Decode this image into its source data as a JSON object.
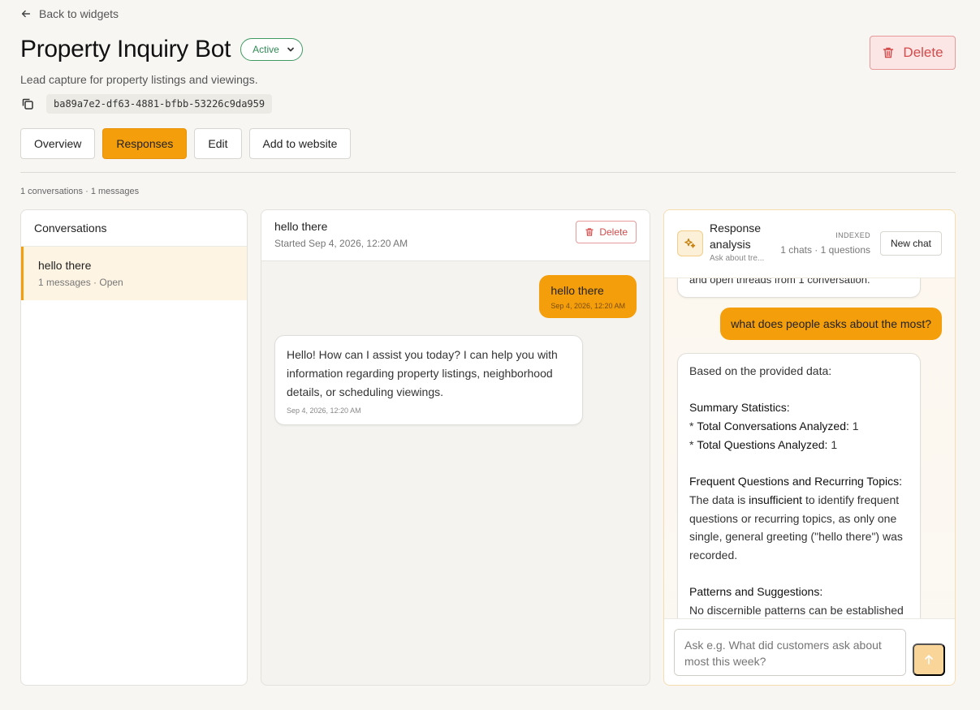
{
  "nav": {
    "back_label": "Back to widgets"
  },
  "header": {
    "title": "Property Inquiry Bot",
    "status": "Active",
    "delete_label": "Delete",
    "subtitle": "Lead capture for property listings and viewings.",
    "widget_id": "ba89a7e2-df63-4881-bfbb-53226c9da959"
  },
  "tabs": [
    {
      "label": "Overview",
      "active": false
    },
    {
      "label": "Responses",
      "active": true
    },
    {
      "label": "Edit",
      "active": false
    },
    {
      "label": "Add to website",
      "active": false
    }
  ],
  "summary": {
    "counts": "1 conversations · 1 messages"
  },
  "conversations": {
    "header": "Conversations",
    "items": [
      {
        "title": "hello there",
        "meta": "1 messages · Open"
      }
    ]
  },
  "chat": {
    "title": "hello there",
    "started": "Started Sep 4, 2026, 12:20 AM",
    "delete_label": "Delete",
    "messages": [
      {
        "role": "user",
        "text": "hello there",
        "time": "Sep 4, 2026, 12:20 AM"
      },
      {
        "role": "bot",
        "text": "Hello! How can I assist you today? I can help you with information regarding property listings, neighborhood details, or scheduling viewings.",
        "time": "Sep 4, 2026, 12:20 AM"
      }
    ]
  },
  "analysis": {
    "title": "Response analysis",
    "subtitle": "Ask about tre...",
    "indexed": "INDEXED",
    "counts": "1 chats · 1 questions",
    "new_chat_label": "New chat",
    "prev_message_tail": "and open threads from 1 conversation.",
    "user_question": "what does people asks about the most?",
    "answer": {
      "intro": "Based on the provided data:",
      "stats_heading": "Summary Statistics:",
      "stat1_label": "Total Conversations Analyzed:",
      "stat1_value": "1",
      "stat2_label": "Total Questions Analyzed:",
      "stat2_value": "1",
      "freq_heading": "Frequent Questions and Recurring Topics:",
      "freq_pre": "The data is ",
      "freq_bold": "insufficient",
      "freq_post": " to identify frequent questions or recurring topics, as only one single, general greeting (\"hello there\") was recorded.",
      "patterns_heading": "Patterns and Suggestions:",
      "patterns_text": "No discernible patterns can be established"
    },
    "input_placeholder": "Ask e.g. What did customers ask about most this week?"
  },
  "colors": {
    "accent": "#f59e0b",
    "danger": "#d34b4b",
    "status_green": "#2f8a53"
  }
}
